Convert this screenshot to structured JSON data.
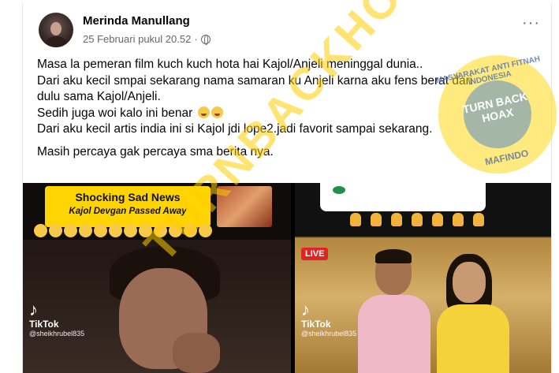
{
  "post": {
    "author": "Merinda Manullang",
    "timestamp": "25 Februari pukul 20.52",
    "separator": "·",
    "privacy_icon": "globe-icon",
    "more_label": "···",
    "lines": [
      "Masa la pemeran film kuch kuch hota hai Kajol/Anjeli meninggal dunia..",
      "Dari aku kecil smpai sekarang nama samaran ku Anjeli karna aku fens berat dari",
      "dulu sama Kajol/Anjeli.",
      "Sedih juga woi kalo ini benar",
      "Dari aku kecil artis india ini si Kajol jdi lope2.jadi favorit sampai sekarang."
    ],
    "last_line": "Masih percaya gak percaya sma berita nya."
  },
  "media": {
    "left": {
      "banner_title": "Shocking Sad News",
      "banner_subtitle": "Kajol Devgan Passed Away",
      "tiktok_name": "TikTok",
      "tiktok_handle": "@sheikhrubel835"
    },
    "right": {
      "live_label": "LIVE",
      "tiktok_name": "TikTok",
      "tiktok_handle": "@sheikhrubel835"
    }
  },
  "watermarks": {
    "diagonal": "TURNBACKHOAX",
    "stamp_center": "TURN BACK HOAX",
    "stamp_ring_top": "MASYARAKAT ANTI FITNAH INDONESIA",
    "stamp_ring_bottom": "MAFINDO"
  },
  "colors": {
    "banner": "#ffd400",
    "live": "#e02424",
    "watermark": "#ffcc00"
  }
}
